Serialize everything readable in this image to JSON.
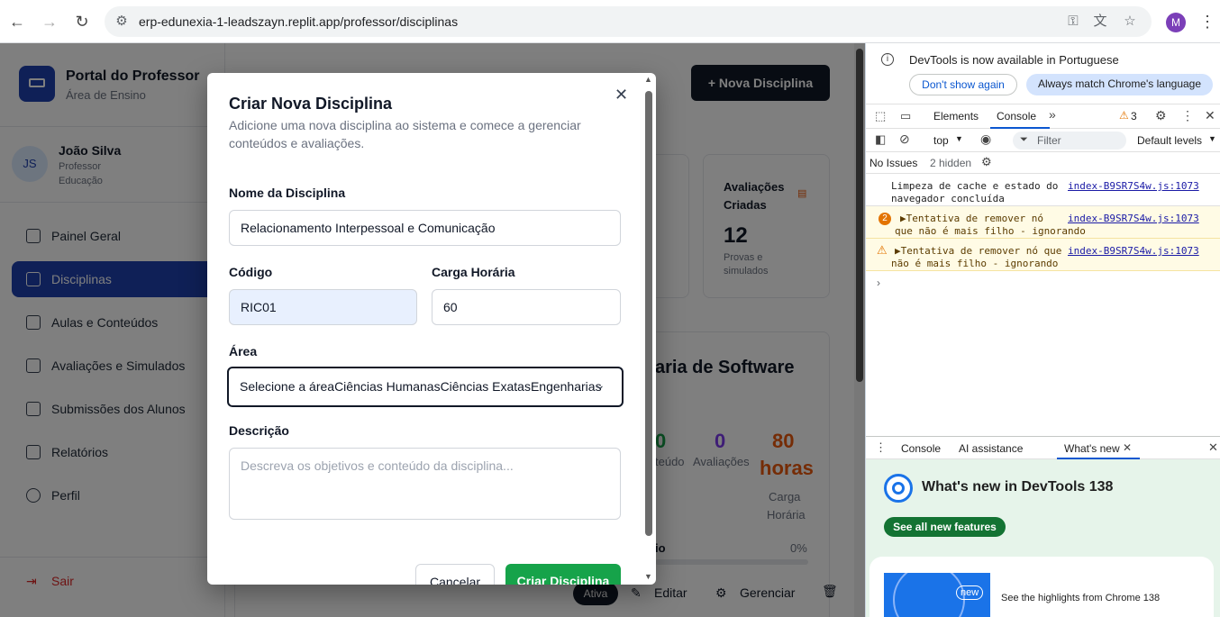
{
  "browser": {
    "url": "erp-edunexia-1-leadszayn.replit.app/professor/disciplinas",
    "profile_initial": "M"
  },
  "app": {
    "portal_title": "Portal do Professor",
    "portal_subtitle": "Área de Ensino",
    "user_initials": "JS",
    "user_name": "João Silva",
    "user_role": "Professor",
    "user_dept": "Educação",
    "nav": [
      {
        "label": "Painel Geral"
      },
      {
        "label": "Disciplinas"
      },
      {
        "label": "Aulas e Conteúdos"
      },
      {
        "label": "Avaliações e Simulados"
      },
      {
        "label": "Submissões dos Alunos"
      },
      {
        "label": "Relatórios"
      },
      {
        "label": "Perfil"
      }
    ],
    "logout": "Sair",
    "new_discipline_button": "+ Nova Disciplina",
    "stat_title_1": "Avaliações",
    "stat_title_2": "Criadas",
    "stat_value": "12",
    "stat_sub_1": "Provas e",
    "stat_sub_2": "simulados",
    "card_title": "aria de Software",
    "card_metric_0": "0",
    "card_metric_0_label": "teúdo",
    "card_metric_1": "0",
    "card_metric_1_label": "Avaliações",
    "card_metric_2a": "80",
    "card_metric_2b": "horas",
    "card_metric_2_label_1": "Carga",
    "card_metric_2_label_2": "Horária",
    "progress_label": "io",
    "progress_value": "0%",
    "status_badge": "Ativa",
    "edit_button": "Editar",
    "manage_button": "Gerenciar"
  },
  "modal": {
    "title": "Criar Nova Disciplina",
    "description_1": "Adicione uma nova disciplina ao sistema e comece a gerenciar",
    "description_2": "conteúdos e avaliações.",
    "name_label": "Nome da Disciplina",
    "name_value": "Relacionamento Interpessoal e Comunicação",
    "code_label": "Código",
    "code_value": "RIC01",
    "hours_label": "Carga Horária",
    "hours_value": "60",
    "area_label": "Área",
    "area_value": "Selecione a áreaCiências HumanasCiências ExatasEngenharias",
    "desc_label": "Descrição",
    "desc_placeholder": "Descreva os objetivos e conteúdo da disciplina...",
    "cancel_button": "Cancelar",
    "submit_button": "Criar Disciplina"
  },
  "devtools": {
    "banner_text": "DevTools is now available in Portuguese",
    "banner_btn_1": "Don't show again",
    "banner_btn_2": "Always match Chrome's language",
    "tab_elements": "Elements",
    "tab_console": "Console",
    "warning_count": "3",
    "context": "top",
    "filter_placeholder": "Filter",
    "levels": "Default levels",
    "issues": "No Issues",
    "hidden": "2 hidden",
    "logs": [
      {
        "text_1": "Limpeza de cache e estado do",
        "text_2": "navegador concluída",
        "source": "index-B9SR7S4w.js:1073",
        "level": "info",
        "count": ""
      },
      {
        "text_1": "▶Tentativa de remover nó",
        "text_2": "que não é mais filho - ignorando",
        "source": "index-B9SR7S4w.js:1073",
        "level": "warning",
        "count": "2"
      },
      {
        "text_1": "▶Tentativa de remover nó que",
        "text_2": "não é mais filho - ignorando",
        "source": "index-B9SR7S4w.js:1073",
        "level": "warning",
        "count": ""
      }
    ],
    "drawer_tab_console": "Console",
    "drawer_tab_ai": "AI assistance",
    "drawer_tab_whatsnew": "What's new",
    "whatsnew_title": "What's new in DevTools 138",
    "whatsnew_button": "See all new features",
    "whatsnew_badge": "new",
    "whatsnew_highlight": "See the highlights from Chrome 138"
  }
}
